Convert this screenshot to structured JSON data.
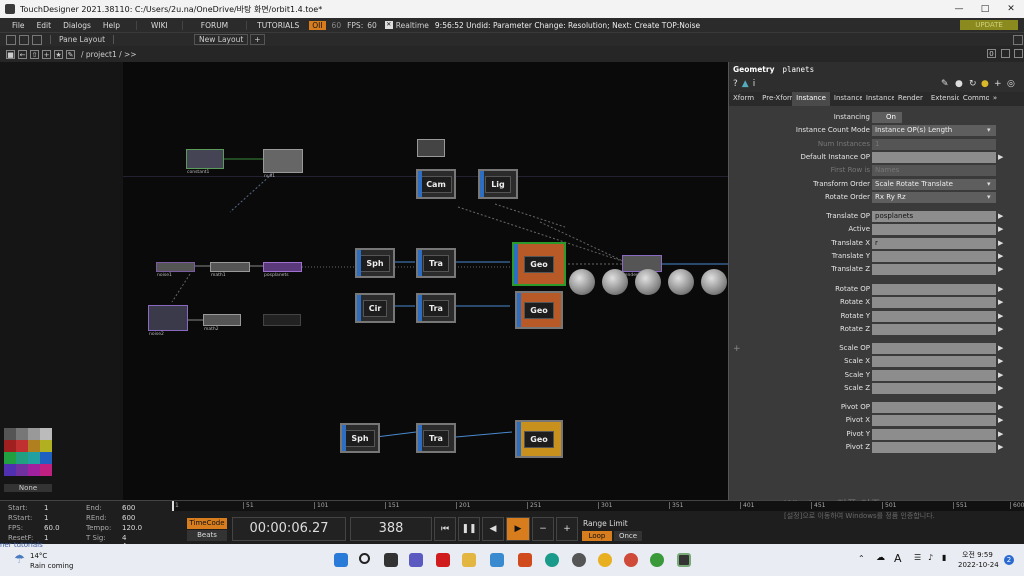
{
  "title_bar": {
    "title": "TouchDesigner 2021.38110: C:/Users/2u.na/OneDrive/바탕 화면/orbit1.4.toe*"
  },
  "menu": {
    "items": [
      "File",
      "Edit",
      "Dialogs",
      "Help"
    ],
    "tabs": [
      "WIKI",
      "FORUM",
      "TUTORIALS"
    ],
    "oii": "OII",
    "fps_small": "60",
    "fps_label": "FPS:",
    "fps_value": "60",
    "realtime": "Realtime",
    "status": "9:56:52 Undid: Parameter Change: Resolution; Next: Create TOP:Noise",
    "update": "UPDATE"
  },
  "pane_bar": {
    "pane_layout": "Pane Layout",
    "new_layout": "New Layout",
    "plus": "+"
  },
  "path_bar": {
    "path": "/ project1 / >>",
    "right_zero": "0"
  },
  "network": {
    "nodes": {
      "constant1": "constant1",
      "null1": "null1",
      "noise1": "noise1",
      "math1": "math1",
      "posplanets": "posplanets",
      "noise2": "noise2",
      "math2": "math2",
      "sphere1": "sphere1",
      "transform1": "transform1",
      "circle1": "circle1",
      "transform2": "transform2",
      "cam1": "cam1",
      "light1": "light1",
      "planets": "planets",
      "tracks": "tracks",
      "render1": "render1",
      "sphere2": "sphere2",
      "transform3": "transform3",
      "sun": "sun"
    },
    "big_labels": {
      "cam": "Cam",
      "lig": "Lig",
      "sph": "Sph",
      "tra": "Tra",
      "geo": "Geo",
      "cir": "Cir"
    },
    "palette_label": "None"
  },
  "params": {
    "op_type": "Geometry",
    "op_name": "planets",
    "tabs": [
      "Xform",
      "Pre-Xform",
      "Instance",
      "Instance",
      "Instance",
      "Render",
      "Extensions",
      "Common",
      "»"
    ],
    "active_tab": "Instance",
    "rows": [
      {
        "label": "Instancing",
        "value": "On",
        "kind": "toggle"
      },
      {
        "label": "Instance Count Mode",
        "value": "Instance OP(s) Length",
        "kind": "drop"
      },
      {
        "label": "Num Instances",
        "value": "1",
        "kind": "dis"
      },
      {
        "label": "Default Instance OP",
        "value": "",
        "kind": "field"
      },
      {
        "label": "First Row is",
        "value": "Names",
        "kind": "dis"
      },
      {
        "label": "Transform Order",
        "value": "Scale Rotate Translate",
        "kind": "drop"
      },
      {
        "label": "Rotate Order",
        "value": "Rx Ry Rz",
        "kind": "drop"
      },
      {
        "label": "Translate OP",
        "value": "posplanets",
        "kind": "field"
      },
      {
        "label": "Active",
        "value": "",
        "kind": "field"
      },
      {
        "label": "Translate X",
        "value": "r",
        "kind": "field"
      },
      {
        "label": "Translate Y",
        "value": "",
        "kind": "field"
      },
      {
        "label": "Translate Z",
        "value": "",
        "kind": "field"
      },
      {
        "label": "Rotate OP",
        "value": "",
        "kind": "field"
      },
      {
        "label": "Rotate X",
        "value": "",
        "kind": "field"
      },
      {
        "label": "Rotate Y",
        "value": "",
        "kind": "field"
      },
      {
        "label": "Rotate Z",
        "value": "",
        "kind": "field"
      },
      {
        "label": "Scale OP",
        "value": "",
        "kind": "field"
      },
      {
        "label": "Scale X",
        "value": "",
        "kind": "field"
      },
      {
        "label": "Scale Y",
        "value": "",
        "kind": "field"
      },
      {
        "label": "Scale Z",
        "value": "",
        "kind": "field"
      },
      {
        "label": "Pivot OP",
        "value": "",
        "kind": "field"
      },
      {
        "label": "Pivot X",
        "value": "",
        "kind": "field"
      },
      {
        "label": "Pivot Y",
        "value": "",
        "kind": "field"
      },
      {
        "label": "Pivot Z",
        "value": "",
        "kind": "field"
      }
    ]
  },
  "timeline": {
    "start_label": "Start:",
    "start": "1",
    "end_label": "End:",
    "end": "600",
    "rstart_label": "RStart:",
    "rstart": "1",
    "rend_label": "REnd:",
    "rend": "600",
    "fps_label": "FPS:",
    "fps": "60.0",
    "tempo_label": "Tempo:",
    "tempo": "120.0",
    "resetf_label": "ResetF:",
    "resetf": "1",
    "tsig_label": "T Sig:",
    "tsig": "4    4",
    "timecode_btn": "TimeCode",
    "beats_btn": "Beats",
    "timecode": "00:00:06.27",
    "frame": "388",
    "range_limit": "Range Limit",
    "loop": "Loop",
    "once": "Once",
    "ruler": [
      "1",
      "51",
      "101",
      "151",
      "201",
      "251",
      "301",
      "351",
      "401",
      "451",
      "501",
      "551",
      "600"
    ],
    "watermark_1": "Windows 정품 인증",
    "watermark_2": "[설정]으로 이동하여 Windows를 정품 인증합니다."
  },
  "taskbar": {
    "weather_temp": "14°C",
    "weather_desc": "Rain coming",
    "ghost": "ner tutorials",
    "lang": "A",
    "time": "오전 9:59",
    "date": "2022-10-24",
    "badge": "2"
  }
}
